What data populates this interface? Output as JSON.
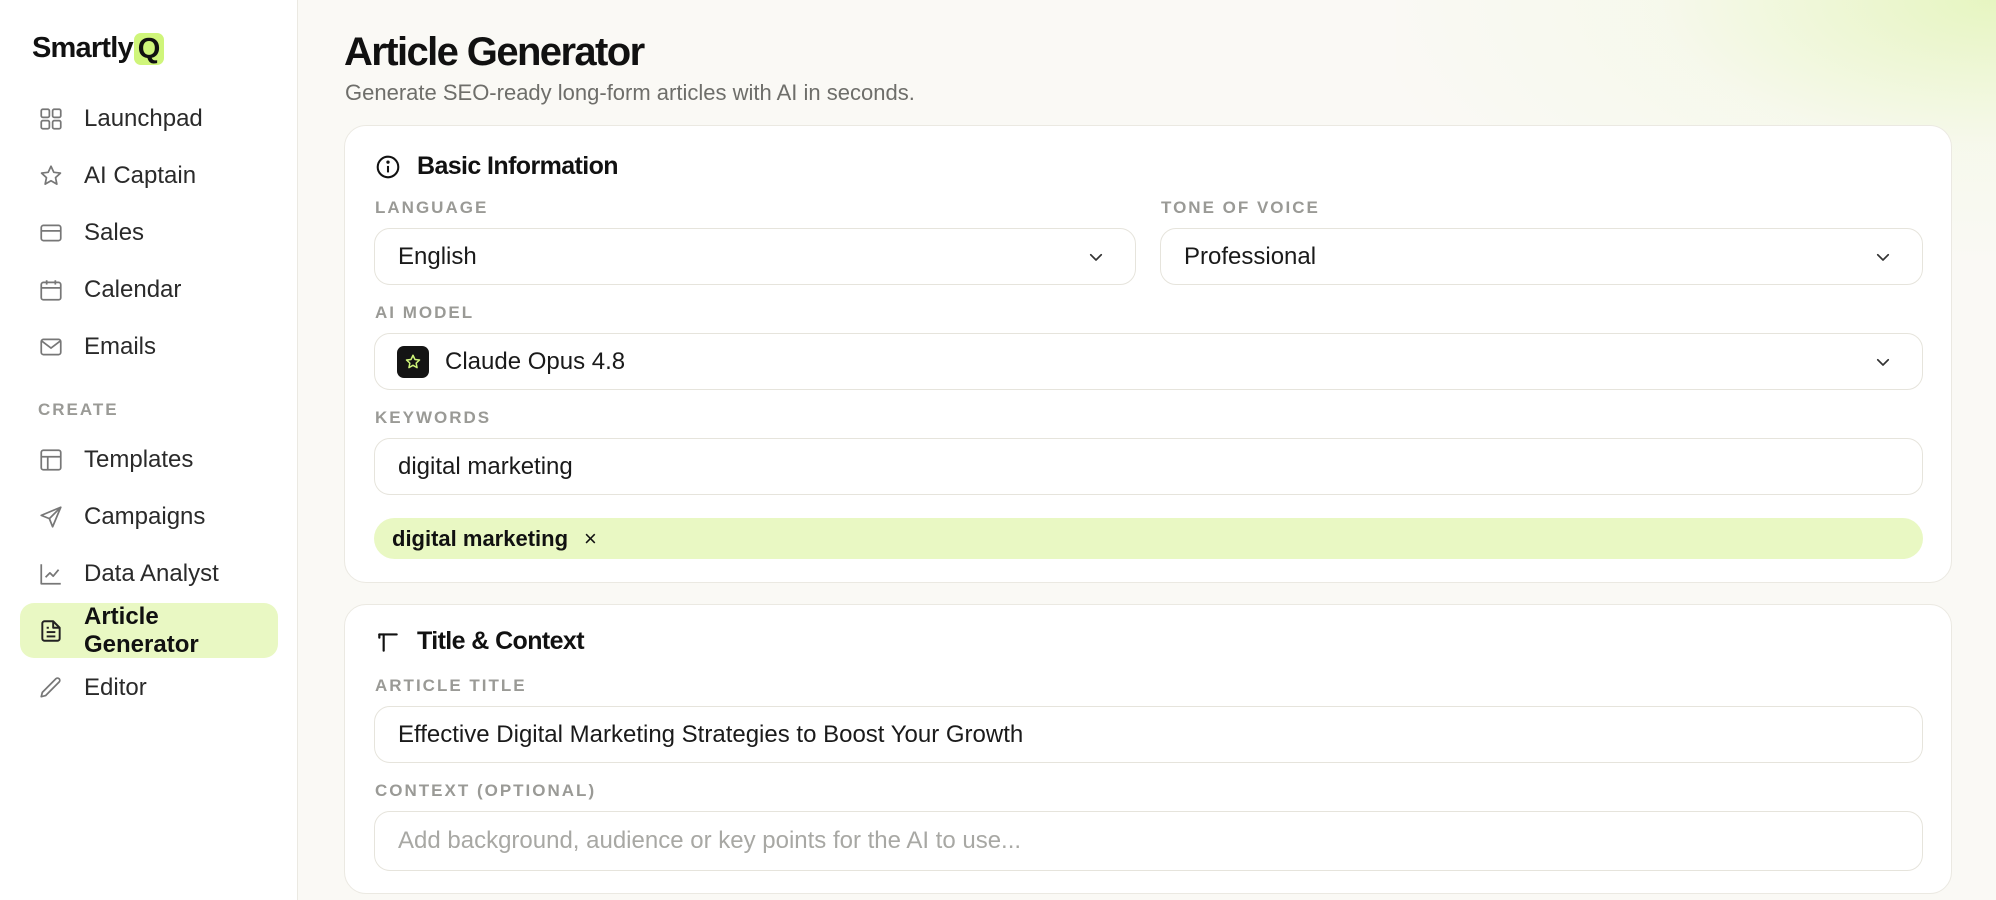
{
  "brand": {
    "name": "Smartly",
    "mark": "Q",
    "accent": "#cff57a"
  },
  "sidebar": {
    "items": [
      {
        "label": "Launchpad",
        "icon": "grid-icon"
      },
      {
        "label": "AI Captain",
        "icon": "star-icon"
      },
      {
        "label": "Sales",
        "icon": "card-icon"
      },
      {
        "label": "Calendar",
        "icon": "calendar-icon"
      },
      {
        "label": "Emails",
        "icon": "mail-icon"
      }
    ],
    "section_label": "CREATE",
    "create_items": [
      {
        "label": "Templates",
        "icon": "layout-icon"
      },
      {
        "label": "Campaigns",
        "icon": "send-icon"
      },
      {
        "label": "Data Analyst",
        "icon": "chart-icon"
      },
      {
        "label": "Article Generator",
        "icon": "document-icon",
        "active": true
      },
      {
        "label": "Editor",
        "icon": "pencil-icon"
      }
    ]
  },
  "header": {
    "title": "Article Generator",
    "subtitle": "Generate SEO-ready long-form articles with AI in seconds."
  },
  "basic_info": {
    "heading": "Basic Information",
    "icon": "info-icon",
    "language": {
      "label": "LANGUAGE",
      "value": "English"
    },
    "tone": {
      "label": "TONE OF VOICE",
      "value": "Professional"
    },
    "model": {
      "label": "AI MODEL",
      "value": "Claude Opus 4.8"
    },
    "keywords": {
      "label": "KEYWORDS",
      "value": "digital marketing",
      "tags": [
        "digital marketing"
      ],
      "remove_glyph": "×"
    }
  },
  "title_context": {
    "heading": "Title & Context",
    "icon": "text-icon",
    "article_title": {
      "label": "ARTICLE TITLE",
      "value": "Effective Digital Marketing Strategies to Boost Your Growth"
    },
    "context": {
      "label": "CONTEXT (OPTIONAL)",
      "placeholder": "Add background, audience or key points for the AI to use..."
    }
  }
}
